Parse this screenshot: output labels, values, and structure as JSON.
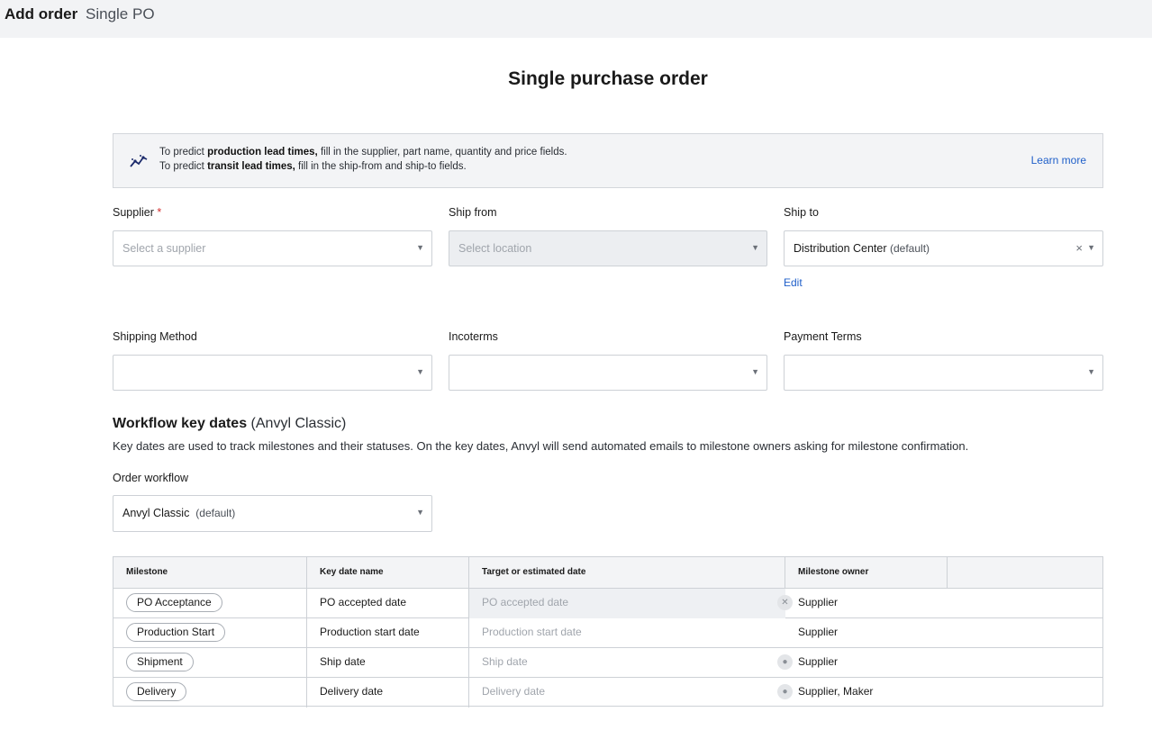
{
  "header": {
    "title": "Add order",
    "subtitle": "Single PO"
  },
  "page_title": "Single purchase order",
  "banner": {
    "line1_pre": "To predict ",
    "line1_bold": "production lead times,",
    "line1_post": " fill in the supplier, part name, quantity and price fields.",
    "line2_pre": "To predict ",
    "line2_bold": "transit lead times,",
    "line2_post": " fill in the ship-from and ship-to fields.",
    "learn_more": "Learn more",
    "icon": "trend-chart-icon"
  },
  "form": {
    "supplier": {
      "label": "Supplier",
      "required_mark": "*",
      "placeholder": "Select a supplier"
    },
    "ship_from": {
      "label": "Ship from",
      "placeholder": "Select location",
      "disabled": true
    },
    "ship_to": {
      "label": "Ship to",
      "value": "Distribution Center",
      "value_suffix": "(default)",
      "edit_label": "Edit"
    },
    "shipping_method": {
      "label": "Shipping Method",
      "value": ""
    },
    "incoterms": {
      "label": "Incoterms",
      "value": ""
    },
    "payment_terms": {
      "label": "Payment Terms",
      "value": ""
    }
  },
  "workflow": {
    "title": "Workflow key dates",
    "title_suffix": "(Anvyl Classic)",
    "description": "Key dates are used to track milestones and their statuses. On the key dates, Anvyl will send automated emails to milestone owners asking for milestone confirmation.",
    "order_workflow_label": "Order workflow",
    "order_workflow_value": "Anvyl Classic",
    "order_workflow_suffix": "(default)"
  },
  "table": {
    "columns": [
      "Milestone",
      "Key date name",
      "Target or estimated date",
      "Milestone owner"
    ],
    "rows": [
      {
        "milestone": "PO Acceptance",
        "key_date": "PO accepted date",
        "target": "PO accepted date",
        "owner": "Supplier",
        "icon": "clear-icon"
      },
      {
        "milestone": "Production Start",
        "key_date": "Production start date",
        "target": "Production start date",
        "owner": "Supplier",
        "icon": ""
      },
      {
        "milestone": "Shipment",
        "key_date": "Ship date",
        "target": "Ship date",
        "owner": "Supplier",
        "icon": "lightbulb-icon"
      },
      {
        "milestone": "Delivery",
        "key_date": "Delivery date",
        "target": "Delivery date",
        "owner": "Supplier, Maker",
        "icon": "lightbulb-icon"
      }
    ]
  }
}
